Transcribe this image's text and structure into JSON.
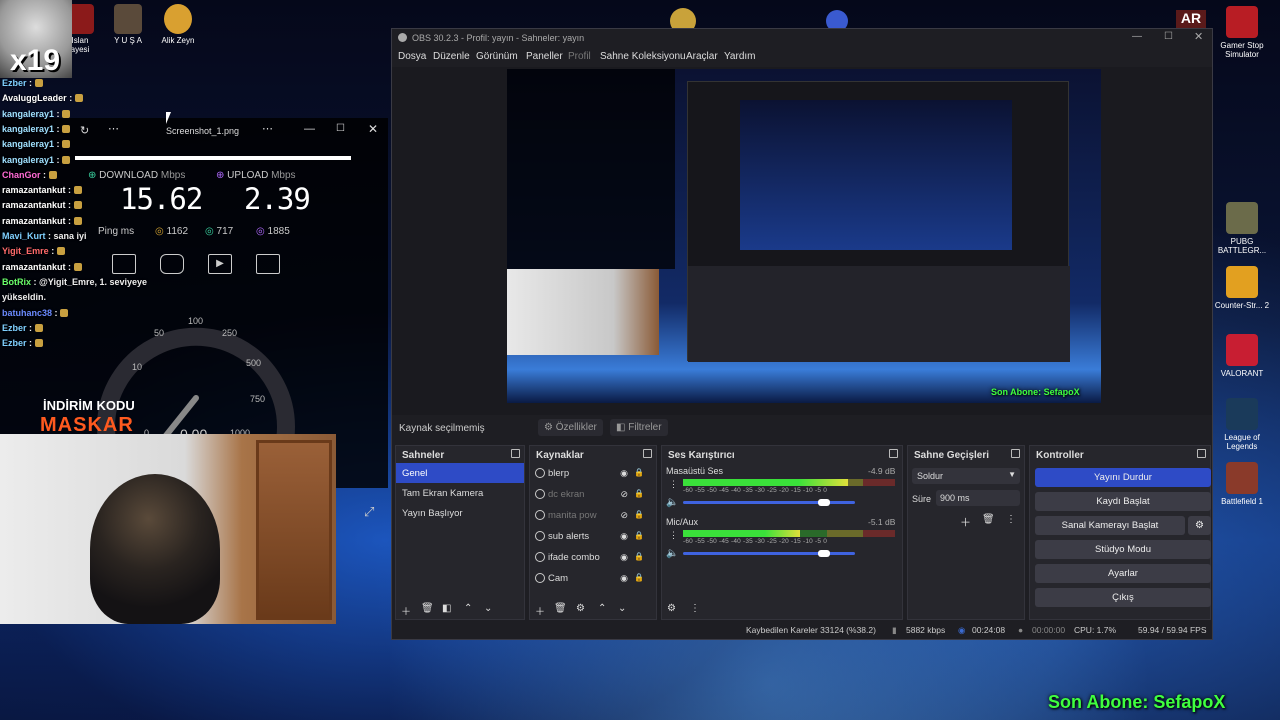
{
  "desktop": {
    "top_icons": [
      {
        "label": "Islan\nayesi",
        "color": "#8b1a1a"
      },
      {
        "label": "Y U Ş A",
        "color": "#5a4a3a"
      },
      {
        "label": "Alik Zeyn",
        "color": "#d9a030"
      }
    ],
    "right_icons": [
      {
        "label": "Gamer Stop Simulator",
        "color": "#b81d24"
      },
      {
        "label": "PUBG BATTLEGR...",
        "color": "#6b6b4a"
      },
      {
        "label": "Counter-Str... 2",
        "color": "#e2a020"
      },
      {
        "label": "VALORANT",
        "color": "#c81e32"
      },
      {
        "label": "League of Legends",
        "color": "#1a3a5a"
      },
      {
        "label": "Battlefield 1",
        "color": "#8a3a2a"
      }
    ],
    "sub_overlay": "Son Abone: SefapoX",
    "avatar_count": "x19"
  },
  "chat": [
    {
      "user": "Ezber",
      "msg": "",
      "color": "#7fd0ff"
    },
    {
      "user": "AvaluggLeader",
      "msg": "",
      "color": "#ffffff"
    },
    {
      "user": "kangaleray1",
      "msg": "",
      "color": "#9fe0ff"
    },
    {
      "user": "kangaleray1",
      "msg": "",
      "color": "#9fe0ff"
    },
    {
      "user": "kangaleray1",
      "msg": "",
      "color": "#9fe0ff"
    },
    {
      "user": "kangaleray1",
      "msg": "",
      "color": "#9fe0ff"
    },
    {
      "user": "ChanGor",
      "msg": "",
      "color": "#ff6ad5"
    },
    {
      "user": "ramazantankut",
      "msg": "",
      "color": "#ffffff"
    },
    {
      "user": "ramazantankut",
      "msg": "",
      "color": "#ffffff"
    },
    {
      "user": "ramazantankut",
      "msg": "",
      "color": "#ffffff"
    },
    {
      "user": "Mavi_Kurt",
      "msg": "sana iyi",
      "color": "#7fd0ff"
    },
    {
      "user": "Yigit_Emre",
      "msg": "",
      "color": "#ff6a6a"
    },
    {
      "user": "ramazantankut",
      "msg": "",
      "color": "#ffffff"
    },
    {
      "user": "BotRix",
      "msg": "@Yigit_Emre, 1. seviyeye",
      "color": "#6aff6a"
    },
    {
      "user": "",
      "msg": "yükseldin.",
      "color": "#ffffff"
    },
    {
      "user": "batuhanc38",
      "msg": "",
      "color": "#6a8aff"
    },
    {
      "user": "Ezber",
      "msg": "",
      "color": "#7fd0ff"
    },
    {
      "user": "Ezber",
      "msg": "",
      "color": "#7fd0ff"
    }
  ],
  "speedtest": {
    "title": "Screenshot_1.png",
    "download_label": "DOWNLOAD",
    "upload_label": "UPLOAD",
    "unit": "Mbps",
    "download": "15.62",
    "upload": "2.39",
    "ping_label": "Ping ms",
    "ping": "1162",
    "jitter_down": "717",
    "jitter_up": "1885",
    "gauge_ticks": [
      "0",
      "10",
      "50",
      "100",
      "250",
      "500",
      "750",
      "1000"
    ],
    "gauge_value": "0.00"
  },
  "promo": {
    "line1": "İNDİRİM KODU",
    "line2": "MASKAR"
  },
  "obs": {
    "title": "OBS 30.2.3 - Profil: yayın - Sahneler: yayın",
    "menu": [
      "Dosya",
      "Düzenle",
      "Görünüm",
      "Paneller",
      "Profil",
      "Sahne Koleksiyonu",
      "Araçlar",
      "Yardım"
    ],
    "source_bar": {
      "status": "Kaynak seçilmemiş",
      "properties": "Özellikler",
      "filters": "Filtreler"
    },
    "scenes_title": "Sahneler",
    "scenes": [
      "Genel",
      "Tam Ekran Kamera",
      "Yayın Başlıyor"
    ],
    "sources_title": "Kaynaklar",
    "sources": [
      {
        "name": "blerp",
        "hidden": false
      },
      {
        "name": "dc ekran",
        "hidden": true
      },
      {
        "name": "manita pow",
        "hidden": true
      },
      {
        "name": "sub alerts",
        "hidden": false
      },
      {
        "name": "ifade combo",
        "hidden": false
      },
      {
        "name": "Cam",
        "hidden": false
      }
    ],
    "mixer_title": "Ses Karıştırıcı",
    "mixer": [
      {
        "name": "Masaüstü Ses",
        "db": "-4.9 dB",
        "level": 0.78,
        "vol": 0.82
      },
      {
        "name": "Mic/Aux",
        "db": "-5.1 dB",
        "level": 0.55,
        "vol": 0.82
      }
    ],
    "mixer_scale": "-60 -55 -50 -45 -40 -35 -30 -25 -20 -15 -10 -5 0",
    "transitions_title": "Sahne Geçişleri",
    "transition": "Soldur",
    "duration_label": "Süre",
    "duration": "900 ms",
    "controls_title": "Kontroller",
    "controls": [
      "Yayını Durdur",
      "Kaydı Başlat",
      "Sanal Kamerayı Başlat",
      "Stüdyo Modu",
      "Ayarlar",
      "Çıkış"
    ],
    "status": {
      "dropped": "Kaybedilen Kareler 33124 (%38.2)",
      "bitrate": "5882 kbps",
      "live": "00:24:08",
      "rec": "00:00:00",
      "cpu": "CPU: 1.7%",
      "fps": "59.94 / 59.94 FPS"
    }
  }
}
